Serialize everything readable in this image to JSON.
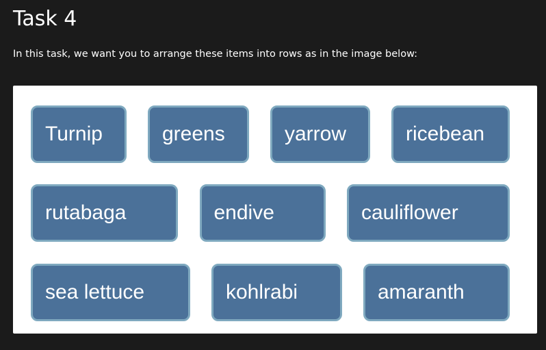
{
  "title": "Task 4",
  "instructions": "In this task, we want you to arrange these items into rows as in the image below:",
  "rows": [
    {
      "items": [
        "Turnip",
        "greens",
        "yarrow",
        "ricebean"
      ]
    },
    {
      "items": [
        "rutabaga",
        "endive",
        "cauliflower"
      ]
    },
    {
      "items": [
        "sea lettuce",
        "kohlrabi",
        "amaranth"
      ]
    }
  ],
  "colors": {
    "page_background": "#1b1b1b",
    "panel_background": "#ffffff",
    "item_fill": "#4b7199",
    "item_border": "#7fa9bf",
    "text": "#ffffff"
  }
}
